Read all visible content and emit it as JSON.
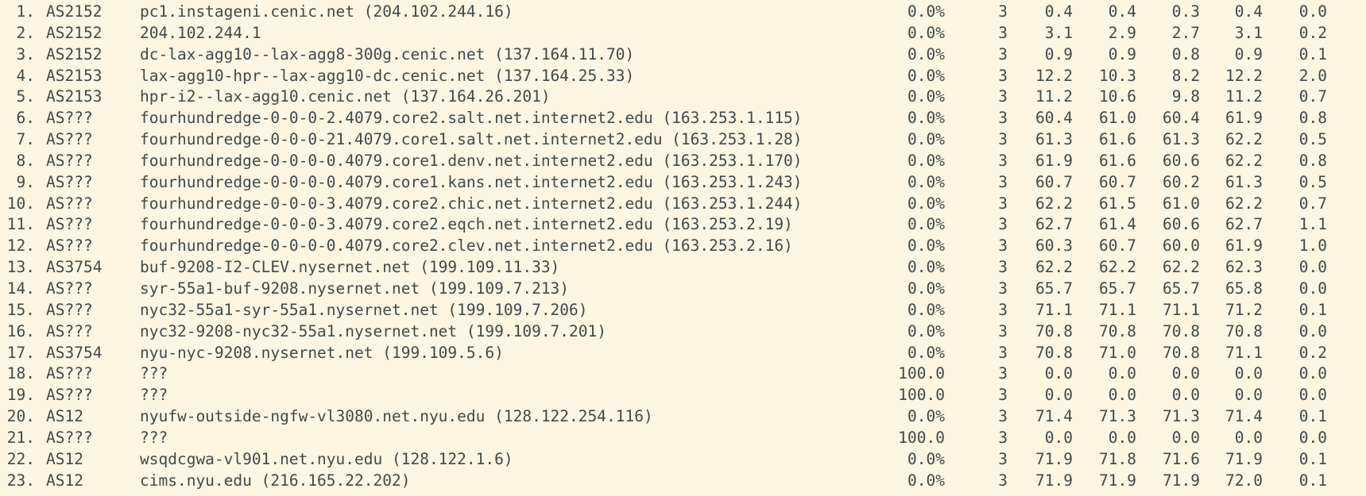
{
  "rows": [
    {
      "hop": "1.",
      "asn": "AS2152",
      "host": "pc1.instageni.cenic.net (204.102.244.16)",
      "loss": "0.0%",
      "snt": "3",
      "last": "0.4",
      "avg": "0.4",
      "best": "0.3",
      "wrst": "0.4",
      "stdev": "0.0"
    },
    {
      "hop": "2.",
      "asn": "AS2152",
      "host": "204.102.244.1",
      "loss": "0.0%",
      "snt": "3",
      "last": "3.1",
      "avg": "2.9",
      "best": "2.7",
      "wrst": "3.1",
      "stdev": "0.2"
    },
    {
      "hop": "3.",
      "asn": "AS2152",
      "host": "dc-lax-agg10--lax-agg8-300g.cenic.net (137.164.11.70)",
      "loss": "0.0%",
      "snt": "3",
      "last": "0.9",
      "avg": "0.9",
      "best": "0.8",
      "wrst": "0.9",
      "stdev": "0.1"
    },
    {
      "hop": "4.",
      "asn": "AS2153",
      "host": "lax-agg10-hpr--lax-agg10-dc.cenic.net (137.164.25.33)",
      "loss": "0.0%",
      "snt": "3",
      "last": "12.2",
      "avg": "10.3",
      "best": "8.2",
      "wrst": "12.2",
      "stdev": "2.0"
    },
    {
      "hop": "5.",
      "asn": "AS2153",
      "host": "hpr-i2--lax-agg10.cenic.net (137.164.26.201)",
      "loss": "0.0%",
      "snt": "3",
      "last": "11.2",
      "avg": "10.6",
      "best": "9.8",
      "wrst": "11.2",
      "stdev": "0.7"
    },
    {
      "hop": "6.",
      "asn": "AS???",
      "host": "fourhundredge-0-0-0-2.4079.core2.salt.net.internet2.edu (163.253.1.115)",
      "loss": "0.0%",
      "snt": "3",
      "last": "60.4",
      "avg": "61.0",
      "best": "60.4",
      "wrst": "61.9",
      "stdev": "0.8"
    },
    {
      "hop": "7.",
      "asn": "AS???",
      "host": "fourhundredge-0-0-0-21.4079.core1.salt.net.internet2.edu (163.253.1.28)",
      "loss": "0.0%",
      "snt": "3",
      "last": "61.3",
      "avg": "61.6",
      "best": "61.3",
      "wrst": "62.2",
      "stdev": "0.5"
    },
    {
      "hop": "8.",
      "asn": "AS???",
      "host": "fourhundredge-0-0-0-0.4079.core1.denv.net.internet2.edu (163.253.1.170)",
      "loss": "0.0%",
      "snt": "3",
      "last": "61.9",
      "avg": "61.6",
      "best": "60.6",
      "wrst": "62.2",
      "stdev": "0.8"
    },
    {
      "hop": "9.",
      "asn": "AS???",
      "host": "fourhundredge-0-0-0-0.4079.core1.kans.net.internet2.edu (163.253.1.243)",
      "loss": "0.0%",
      "snt": "3",
      "last": "60.7",
      "avg": "60.7",
      "best": "60.2",
      "wrst": "61.3",
      "stdev": "0.5"
    },
    {
      "hop": "10.",
      "asn": "AS???",
      "host": "fourhundredge-0-0-0-3.4079.core2.chic.net.internet2.edu (163.253.1.244)",
      "loss": "0.0%",
      "snt": "3",
      "last": "62.2",
      "avg": "61.5",
      "best": "61.0",
      "wrst": "62.2",
      "stdev": "0.7"
    },
    {
      "hop": "11.",
      "asn": "AS???",
      "host": "fourhundredge-0-0-0-3.4079.core2.eqch.net.internet2.edu (163.253.2.19)",
      "loss": "0.0%",
      "snt": "3",
      "last": "62.7",
      "avg": "61.4",
      "best": "60.6",
      "wrst": "62.7",
      "stdev": "1.1"
    },
    {
      "hop": "12.",
      "asn": "AS???",
      "host": "fourhundredge-0-0-0-0.4079.core2.clev.net.internet2.edu (163.253.2.16)",
      "loss": "0.0%",
      "snt": "3",
      "last": "60.3",
      "avg": "60.7",
      "best": "60.0",
      "wrst": "61.9",
      "stdev": "1.0"
    },
    {
      "hop": "13.",
      "asn": "AS3754",
      "host": "buf-9208-I2-CLEV.nysernet.net (199.109.11.33)",
      "loss": "0.0%",
      "snt": "3",
      "last": "62.2",
      "avg": "62.2",
      "best": "62.2",
      "wrst": "62.3",
      "stdev": "0.0"
    },
    {
      "hop": "14.",
      "asn": "AS???",
      "host": "syr-55a1-buf-9208.nysernet.net (199.109.7.213)",
      "loss": "0.0%",
      "snt": "3",
      "last": "65.7",
      "avg": "65.7",
      "best": "65.7",
      "wrst": "65.8",
      "stdev": "0.0"
    },
    {
      "hop": "15.",
      "asn": "AS???",
      "host": "nyc32-55a1-syr-55a1.nysernet.net (199.109.7.206)",
      "loss": "0.0%",
      "snt": "3",
      "last": "71.1",
      "avg": "71.1",
      "best": "71.1",
      "wrst": "71.2",
      "stdev": "0.1"
    },
    {
      "hop": "16.",
      "asn": "AS???",
      "host": "nyc32-9208-nyc32-55a1.nysernet.net (199.109.7.201)",
      "loss": "0.0%",
      "snt": "3",
      "last": "70.8",
      "avg": "70.8",
      "best": "70.8",
      "wrst": "70.8",
      "stdev": "0.0"
    },
    {
      "hop": "17.",
      "asn": "AS3754",
      "host": "nyu-nyc-9208.nysernet.net (199.109.5.6)",
      "loss": "0.0%",
      "snt": "3",
      "last": "70.8",
      "avg": "71.0",
      "best": "70.8",
      "wrst": "71.1",
      "stdev": "0.2"
    },
    {
      "hop": "18.",
      "asn": "AS???",
      "host": "???",
      "loss": "100.0",
      "snt": "3",
      "last": "0.0",
      "avg": "0.0",
      "best": "0.0",
      "wrst": "0.0",
      "stdev": "0.0"
    },
    {
      "hop": "19.",
      "asn": "AS???",
      "host": "???",
      "loss": "100.0",
      "snt": "3",
      "last": "0.0",
      "avg": "0.0",
      "best": "0.0",
      "wrst": "0.0",
      "stdev": "0.0"
    },
    {
      "hop": "20.",
      "asn": "AS12",
      "host": "nyufw-outside-ngfw-vl3080.net.nyu.edu (128.122.254.116)",
      "loss": "0.0%",
      "snt": "3",
      "last": "71.4",
      "avg": "71.3",
      "best": "71.3",
      "wrst": "71.4",
      "stdev": "0.1"
    },
    {
      "hop": "21.",
      "asn": "AS???",
      "host": "???",
      "loss": "100.0",
      "snt": "3",
      "last": "0.0",
      "avg": "0.0",
      "best": "0.0",
      "wrst": "0.0",
      "stdev": "0.0"
    },
    {
      "hop": "22.",
      "asn": "AS12",
      "host": "wsqdcgwa-vl901.net.nyu.edu (128.122.1.6)",
      "loss": "0.0%",
      "snt": "3",
      "last": "71.9",
      "avg": "71.8",
      "best": "71.6",
      "wrst": "71.9",
      "stdev": "0.1"
    },
    {
      "hop": "23.",
      "asn": "AS12",
      "host": "cims.nyu.edu (216.165.22.202)",
      "loss": "0.0%",
      "snt": "3",
      "last": "71.9",
      "avg": "71.9",
      "best": "71.9",
      "wrst": "72.0",
      "stdev": "0.1"
    }
  ]
}
